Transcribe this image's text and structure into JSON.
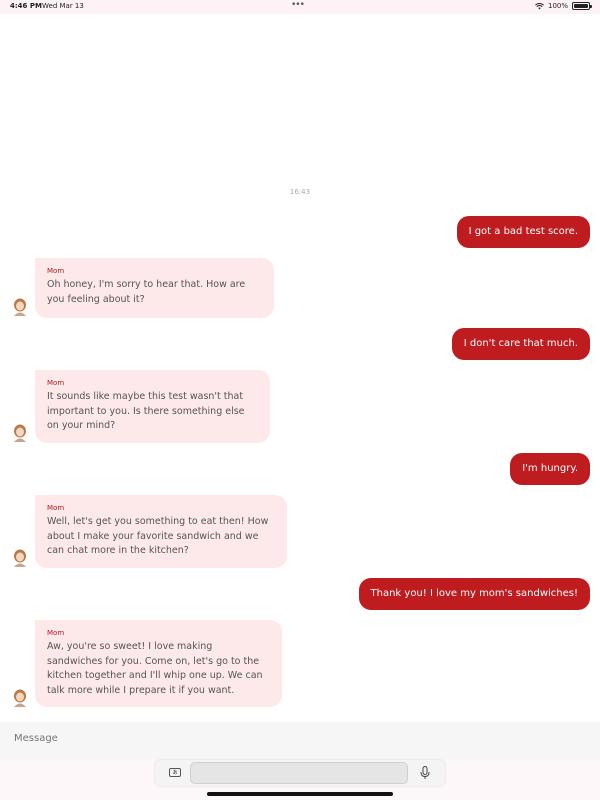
{
  "status_bar": {
    "time": "4:46 PM",
    "date": "Wed Mar 13",
    "battery": "100%"
  },
  "chat": {
    "timestamp": "16:43",
    "messages": [
      {
        "from": "user",
        "text": "I got a bad test score."
      },
      {
        "from": "mom",
        "sender": "Mom",
        "text": "Oh honey, I'm sorry to hear that. How are you feeling about it?"
      },
      {
        "from": "user",
        "text": "I don't care that much."
      },
      {
        "from": "mom",
        "sender": "Mom",
        "text": "It sounds like maybe this test wasn't that important to you. Is there something else on your mind?"
      },
      {
        "from": "user",
        "text": "I'm hungry."
      },
      {
        "from": "mom",
        "sender": "Mom",
        "text": "Well, let's get you something to eat then! How about I make your favorite sandwich and we can chat more in the kitchen?"
      },
      {
        "from": "user",
        "text": "Thank you! I love my mom's sandwiches!"
      },
      {
        "from": "mom",
        "sender": "Mom",
        "text": "Aw, you're so sweet! I love making sandwiches for you. Come on, let's go to the kitchen together and I'll whip one up. We can talk more while I prepare it if you want."
      }
    ]
  },
  "composer": {
    "placeholder": "Message"
  },
  "keyboard_toolbar": {
    "lang_label": "あ"
  },
  "colors": {
    "outgoing_bubble": "#bf1c1f",
    "incoming_bubble": "#fde8ea",
    "sender_name": "#b01c22"
  }
}
